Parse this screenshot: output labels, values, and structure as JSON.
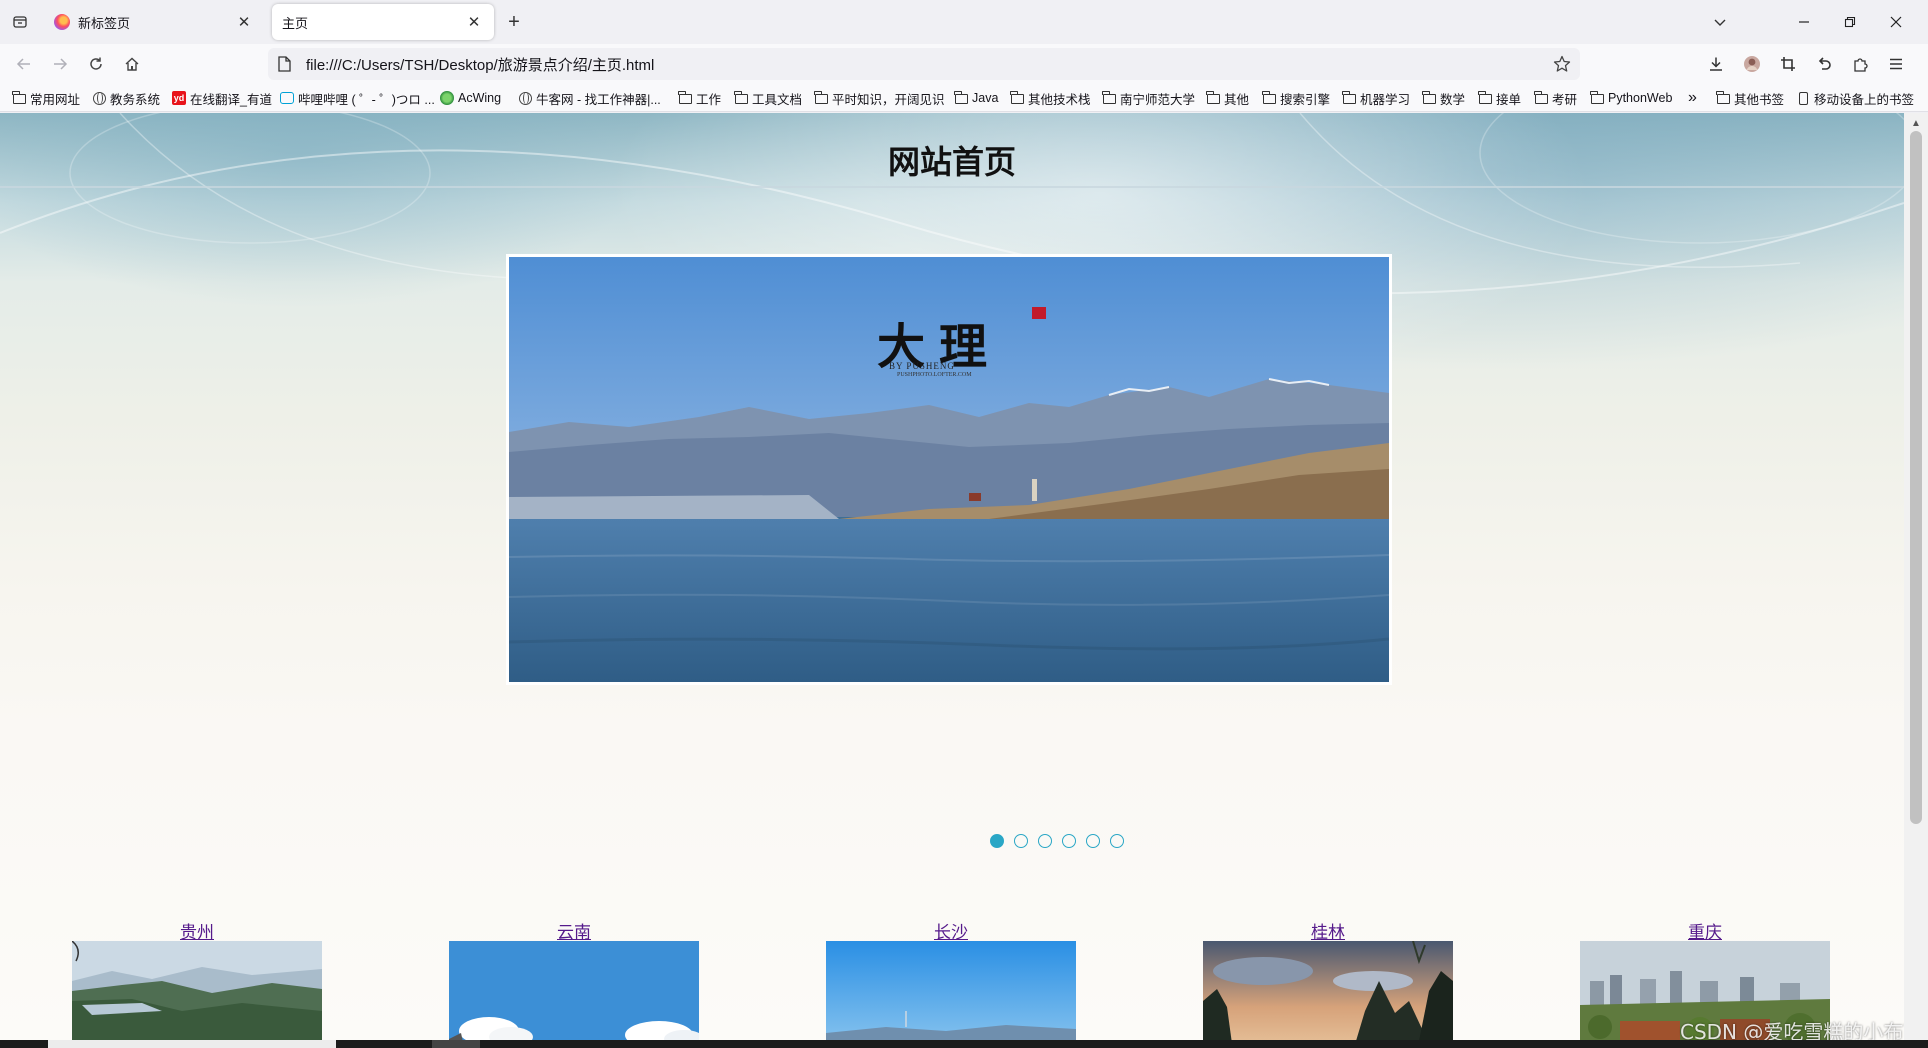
{
  "browser": {
    "tabs": [
      {
        "title": "新标签页",
        "active": false
      },
      {
        "title": "主页",
        "active": true
      }
    ],
    "new_tab_glyph": "+",
    "close_glyph": "✕",
    "url": "file:///C:/Users/TSH/Desktop/旅游景点介绍/主页.html",
    "bookmarks": [
      {
        "label": "常用网址",
        "icon": "folder-icon"
      },
      {
        "label": "教务系统",
        "icon": "globe-icon"
      },
      {
        "label": "在线翻译_有道",
        "icon": "youdao-icon"
      },
      {
        "label": "哔哩哔哩 ( ゜- ゜)つロ ...",
        "icon": "bilibili-icon"
      },
      {
        "label": "AcWing",
        "icon": "acwing-icon"
      },
      {
        "label": "牛客网 - 找工作神器|...",
        "icon": "globe-icon"
      },
      {
        "label": "工作",
        "icon": "folder-icon"
      },
      {
        "label": "工具文档",
        "icon": "folder-icon"
      },
      {
        "label": "平时知识，开阔见识",
        "icon": "folder-icon"
      },
      {
        "label": "Java",
        "icon": "folder-icon"
      },
      {
        "label": "其他技术栈",
        "icon": "folder-icon"
      },
      {
        "label": "南宁师范大学",
        "icon": "folder-icon"
      },
      {
        "label": "其他",
        "icon": "folder-icon"
      },
      {
        "label": "搜索引擎",
        "icon": "folder-icon"
      },
      {
        "label": "机器学习",
        "icon": "folder-icon"
      },
      {
        "label": "数学",
        "icon": "folder-icon"
      },
      {
        "label": "接单",
        "icon": "folder-icon"
      },
      {
        "label": "考研",
        "icon": "folder-icon"
      },
      {
        "label": "PythonWeb",
        "icon": "folder-icon"
      }
    ],
    "overflow_glyph": "»",
    "other_bookmarks": "其他书签",
    "mobile_bookmarks": "移动设备上的书签"
  },
  "page": {
    "title": "网站首页",
    "slider": {
      "caption": "大理",
      "caption_sub": "BY PUSHENG",
      "caption_sub2": "PUSHPHOTO.LOFTER.COM",
      "slide_count": 6,
      "active_index": 0
    },
    "destinations": [
      {
        "name": "贵州"
      },
      {
        "name": "云南"
      },
      {
        "name": "长沙"
      },
      {
        "name": "桂林"
      },
      {
        "name": "重庆"
      }
    ],
    "watermark": "CSDN @爱吃雪糕的小布丁"
  },
  "colors": {
    "accent_dot": "#2aa7c6",
    "visited_link": "#551a8b"
  }
}
